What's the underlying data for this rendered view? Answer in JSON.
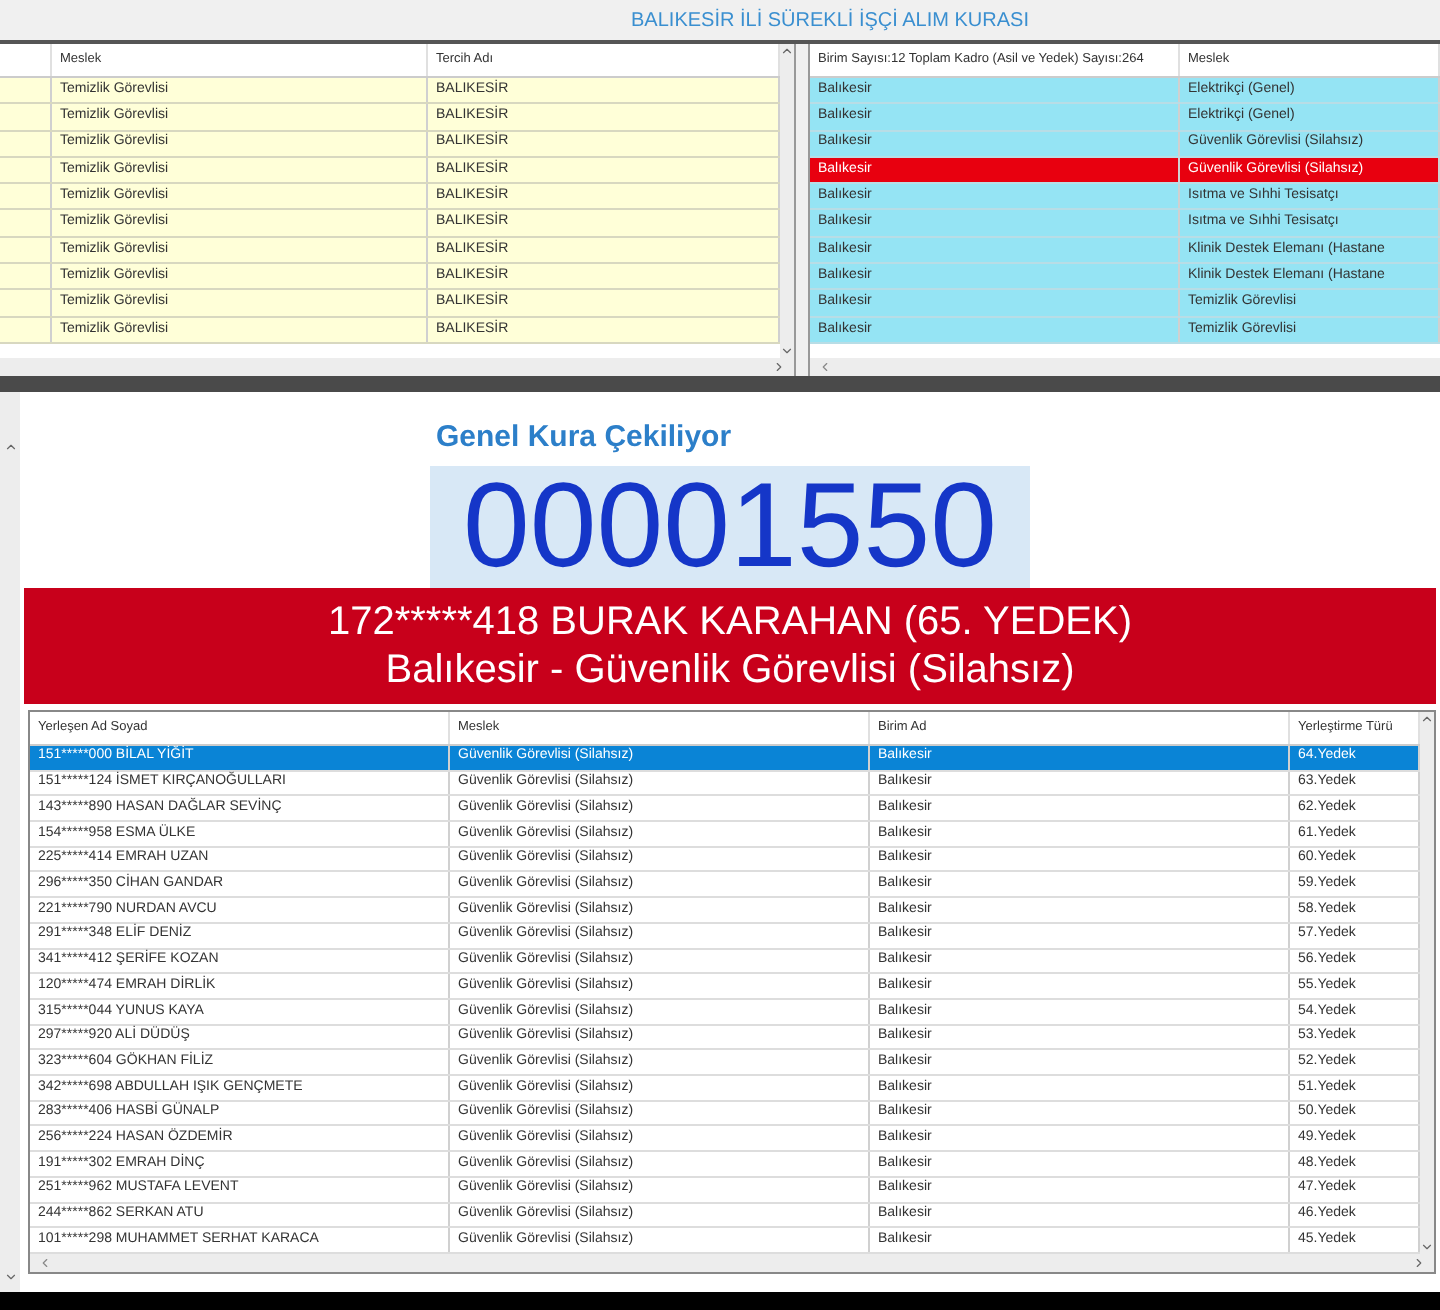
{
  "title": "BALIKESİR İLİ SÜREKLİ İŞÇİ ALIM KURASI",
  "preference_table": {
    "columns": [
      "Meslek",
      "Tercih Adı"
    ],
    "rows": [
      {
        "column_1": "",
        "meslek": "Temizlik Görevlisi",
        "tercih": "BALIKESİR"
      },
      {
        "column_1": "",
        "meslek": "Temizlik Görevlisi",
        "tercih": "BALIKESİR"
      },
      {
        "column_1": "",
        "meslek": "Temizlik Görevlisi",
        "tercih": "BALIKESİR"
      },
      {
        "column_1": "",
        "meslek": "Temizlik Görevlisi",
        "tercih": "BALIKESİR"
      },
      {
        "column_1": "",
        "meslek": "Temizlik Görevlisi",
        "tercih": "BALIKESİR"
      },
      {
        "column_1": "",
        "meslek": "Temizlik Görevlisi",
        "tercih": "BALIKESİR"
      },
      {
        "column_1": "",
        "meslek": "Temizlik Görevlisi",
        "tercih": "BALIKESİR"
      },
      {
        "column_1": "",
        "meslek": "Temizlik Görevlisi",
        "tercih": "BALIKESİR"
      },
      {
        "column_1": "",
        "meslek": "Temizlik Görevlisi",
        "tercih": "BALIKESİR"
      },
      {
        "column_1": "",
        "meslek": "Temizlik Görevlisi",
        "tercih": "BALIKESİR"
      }
    ]
  },
  "unit_table": {
    "columns": [
      "Birim Sayısı:12 Toplam Kadro (Asil ve Yedek) Sayısı:264",
      "Meslek"
    ],
    "rows": [
      {
        "birim": "Balıkesir",
        "meslek": "Elektrikçi (Genel)",
        "selected": false
      },
      {
        "birim": "Balıkesir",
        "meslek": "Elektrikçi (Genel)",
        "selected": false
      },
      {
        "birim": "Balıkesir",
        "meslek": "Güvenlik Görevlisi (Silahsız)",
        "selected": false
      },
      {
        "birim": "Balıkesir",
        "meslek": "Güvenlik Görevlisi (Silahsız)",
        "selected": true
      },
      {
        "birim": "Balıkesir",
        "meslek": "Isıtma ve Sıhhi Tesisatçı",
        "selected": false
      },
      {
        "birim": "Balıkesir",
        "meslek": "Isıtma ve Sıhhi Tesisatçı",
        "selected": false
      },
      {
        "birim": "Balıkesir",
        "meslek": "Klinik Destek Elemanı (Hastane",
        "selected": false
      },
      {
        "birim": "Balıkesir",
        "meslek": "Klinik Destek Elemanı (Hastane",
        "selected": false
      },
      {
        "birim": "Balıkesir",
        "meslek": "Temizlik Görevlisi",
        "selected": false
      },
      {
        "birim": "Balıkesir",
        "meslek": "Temizlik Görevlisi",
        "selected": false
      }
    ]
  },
  "draw": {
    "heading": "Genel Kura Çekiliyor",
    "number": "00001550",
    "winner_line": "172*****418 BURAK KARAHAN (65. YEDEK)",
    "winner_place": "Balıkesir - Güvenlik Görevlisi (Silahsız)"
  },
  "results_table": {
    "columns": [
      "Yerleşen Ad Soyad",
      "Meslek",
      "Birim Ad",
      "Yerleştirme Türü"
    ],
    "rows": [
      {
        "name": "151*****000 BİLAL YİĞİT",
        "meslek": "Güvenlik Görevlisi (Silahsız)",
        "birim": "Balıkesir",
        "tur": "64.Yedek",
        "selected": true
      },
      {
        "name": "151*****124 İSMET KIRÇANOĞULLARI",
        "meslek": "Güvenlik Görevlisi (Silahsız)",
        "birim": "Balıkesir",
        "tur": "63.Yedek",
        "selected": false
      },
      {
        "name": "143*****890 HASAN DAĞLAR SEVİNÇ",
        "meslek": "Güvenlik Görevlisi (Silahsız)",
        "birim": "Balıkesir",
        "tur": "62.Yedek",
        "selected": false
      },
      {
        "name": "154*****958 ESMA ÜLKE",
        "meslek": "Güvenlik Görevlisi (Silahsız)",
        "birim": "Balıkesir",
        "tur": "61.Yedek",
        "selected": false
      },
      {
        "name": "225*****414 EMRAH UZAN",
        "meslek": "Güvenlik Görevlisi (Silahsız)",
        "birim": "Balıkesir",
        "tur": "60.Yedek",
        "selected": false
      },
      {
        "name": "296*****350 CİHAN GANDAR",
        "meslek": "Güvenlik Görevlisi (Silahsız)",
        "birim": "Balıkesir",
        "tur": "59.Yedek",
        "selected": false
      },
      {
        "name": "221*****790 NURDAN AVCU",
        "meslek": "Güvenlik Görevlisi (Silahsız)",
        "birim": "Balıkesir",
        "tur": "58.Yedek",
        "selected": false
      },
      {
        "name": "291*****348 ELİF DENİZ",
        "meslek": "Güvenlik Görevlisi (Silahsız)",
        "birim": "Balıkesir",
        "tur": "57.Yedek",
        "selected": false
      },
      {
        "name": "341*****412 ŞERİFE KOZAN",
        "meslek": "Güvenlik Görevlisi (Silahsız)",
        "birim": "Balıkesir",
        "tur": "56.Yedek",
        "selected": false
      },
      {
        "name": "120*****474 EMRAH DİRLİK",
        "meslek": "Güvenlik Görevlisi (Silahsız)",
        "birim": "Balıkesir",
        "tur": "55.Yedek",
        "selected": false
      },
      {
        "name": "315*****044 YUNUS KAYA",
        "meslek": "Güvenlik Görevlisi (Silahsız)",
        "birim": "Balıkesir",
        "tur": "54.Yedek",
        "selected": false
      },
      {
        "name": "297*****920 ALİ DÜDÜŞ",
        "meslek": "Güvenlik Görevlisi (Silahsız)",
        "birim": "Balıkesir",
        "tur": "53.Yedek",
        "selected": false
      },
      {
        "name": "323*****604 GÖKHAN FİLİZ",
        "meslek": "Güvenlik Görevlisi (Silahsız)",
        "birim": "Balıkesir",
        "tur": "52.Yedek",
        "selected": false
      },
      {
        "name": "342*****698 ABDULLAH IŞIK GENÇMETE",
        "meslek": "Güvenlik Görevlisi (Silahsız)",
        "birim": "Balıkesir",
        "tur": "51.Yedek",
        "selected": false
      },
      {
        "name": "283*****406 HASBİ GÜNALP",
        "meslek": "Güvenlik Görevlisi (Silahsız)",
        "birim": "Balıkesir",
        "tur": "50.Yedek",
        "selected": false
      },
      {
        "name": "256*****224 HASAN ÖZDEMİR",
        "meslek": "Güvenlik Görevlisi (Silahsız)",
        "birim": "Balıkesir",
        "tur": "49.Yedek",
        "selected": false
      },
      {
        "name": "191*****302 EMRAH DİNÇ",
        "meslek": "Güvenlik Görevlisi (Silahsız)",
        "birim": "Balıkesir",
        "tur": "48.Yedek",
        "selected": false
      },
      {
        "name": "251*****962 MUSTAFA LEVENT",
        "meslek": "Güvenlik Görevlisi (Silahsız)",
        "birim": "Balıkesir",
        "tur": "47.Yedek",
        "selected": false
      },
      {
        "name": "244*****862 SERKAN ATU",
        "meslek": "Güvenlik Görevlisi (Silahsız)",
        "birim": "Balıkesir",
        "tur": "46.Yedek",
        "selected": false
      },
      {
        "name": "101*****298 MUHAMMET SERHAT KARACA",
        "meslek": "Güvenlik Görevlisi (Silahsız)",
        "birim": "Balıkesir",
        "tur": "45.Yedek",
        "selected": false
      }
    ]
  }
}
